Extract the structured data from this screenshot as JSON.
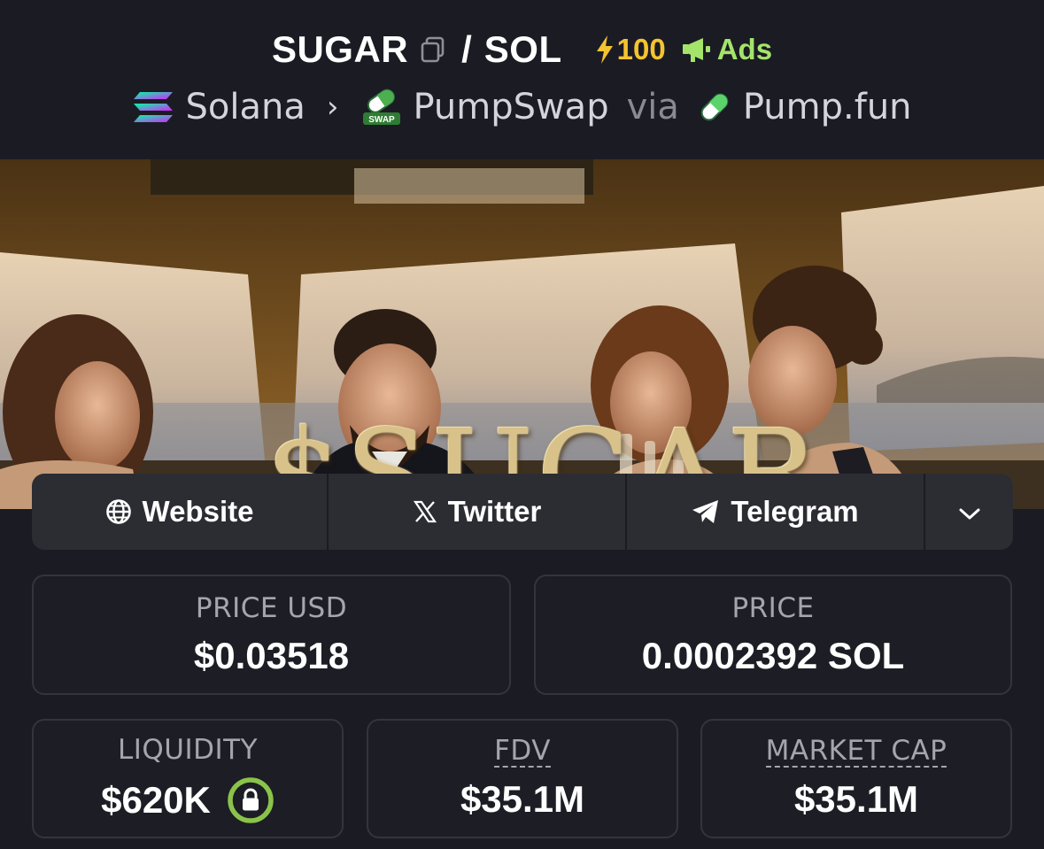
{
  "header": {
    "base_symbol": "SUGAR",
    "slash": "/",
    "quote_symbol": "SOL",
    "boost_count": "100",
    "ads_label": "Ads",
    "chain": "Solana",
    "dex": "PumpSwap",
    "via": "via",
    "launchpad": "Pump.fun",
    "swap_badge": "SWAP"
  },
  "banner": {
    "title": "$SUGAR"
  },
  "socials": {
    "website": "Website",
    "twitter": "Twitter",
    "telegram": "Telegram"
  },
  "stats": {
    "price_usd_label": "PRICE USD",
    "price_usd": "$0.03518",
    "price_label": "PRICE",
    "price_native": "0.0002392 SOL",
    "liquidity_label": "LIQUIDITY",
    "liquidity": "$620K",
    "fdv_label": "FDV",
    "fdv": "$35.1M",
    "market_cap_label": "MARKET CAP",
    "market_cap": "$35.1M"
  },
  "colors": {
    "background": "#1b1b24",
    "boost": "#f4c430",
    "ads": "#a4e46a",
    "lock_ring": "#8bc34a"
  },
  "icons": [
    "copy-icon",
    "lightning-icon",
    "megaphone-icon",
    "solana-logo-icon",
    "pumpswap-logo-icon",
    "pill-icon",
    "globe-icon",
    "x-icon",
    "telegram-icon",
    "chevron-down-icon",
    "lock-icon"
  ]
}
